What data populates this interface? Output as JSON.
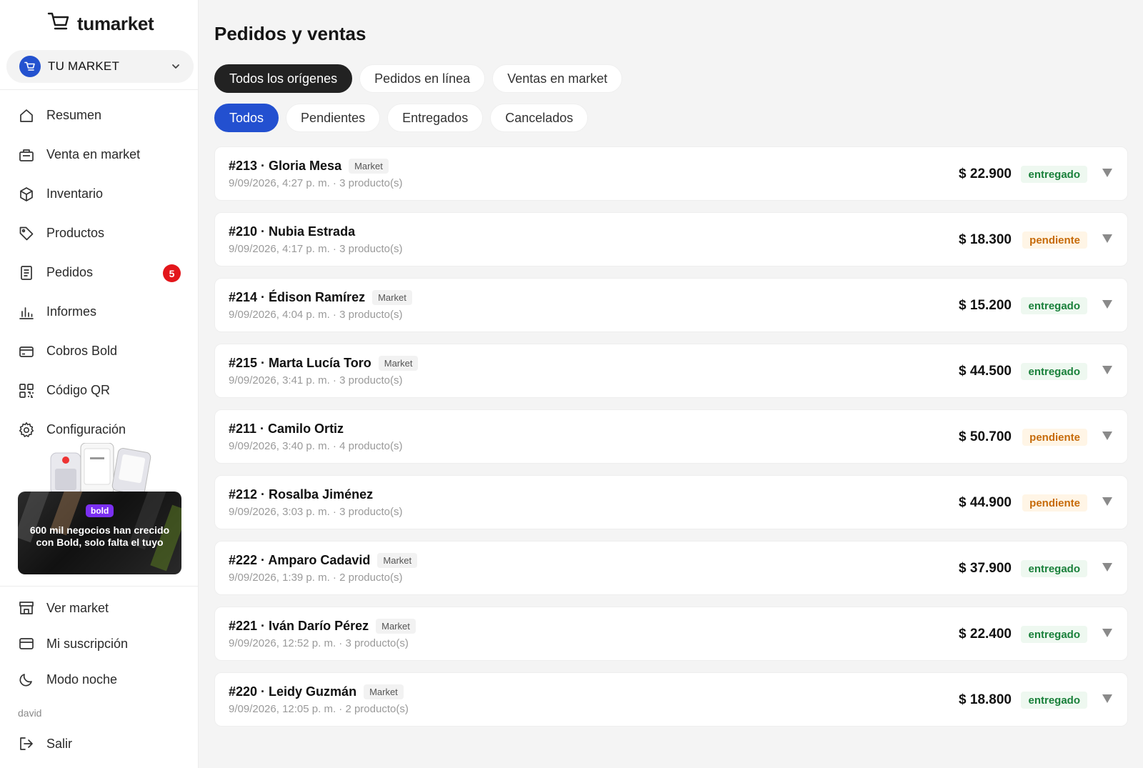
{
  "brand": {
    "name": "tumarket",
    "logo_icon": "cart-icon"
  },
  "store": {
    "name": "TU MARKET",
    "icon": "cart-icon"
  },
  "nav": [
    {
      "label": "Resumen",
      "icon": "home-icon"
    },
    {
      "label": "Venta en market",
      "icon": "register-icon"
    },
    {
      "label": "Inventario",
      "icon": "box-icon"
    },
    {
      "label": "Productos",
      "icon": "tag-icon"
    },
    {
      "label": "Pedidos",
      "icon": "document-icon",
      "badge": "5"
    },
    {
      "label": "Informes",
      "icon": "bar-chart-icon"
    },
    {
      "label": "Cobros Bold",
      "icon": "credit-card-icon"
    },
    {
      "label": "Código QR",
      "icon": "qr-code-icon"
    },
    {
      "label": "Configuración",
      "icon": "gear-icon"
    }
  ],
  "promo": {
    "brand": "bold",
    "text": "600 mil negocios han crecido con Bold, solo falta el tuyo"
  },
  "bottom_nav": [
    {
      "label": "Ver market",
      "icon": "storefront-icon"
    },
    {
      "label": "Mi suscripción",
      "icon": "card-icon"
    },
    {
      "label": "Modo noche",
      "icon": "moon-icon"
    }
  ],
  "user": {
    "name": "david",
    "logout_label": "Salir"
  },
  "page": {
    "title": "Pedidos y ventas"
  },
  "source_filters": [
    {
      "label": "Todos los orígenes",
      "active": true
    },
    {
      "label": "Pedidos en línea",
      "active": false
    },
    {
      "label": "Ventas en market",
      "active": false
    }
  ],
  "status_filters": [
    {
      "label": "Todos",
      "active": true
    },
    {
      "label": "Pendientes",
      "active": false
    },
    {
      "label": "Entregados",
      "active": false
    },
    {
      "label": "Cancelados",
      "active": false
    }
  ],
  "orders": [
    {
      "title": "#213 · Gloria Mesa",
      "tag": "Market",
      "meta": "9/09/2026, 4:27 p. m. · 3 producto(s)",
      "amount": "$ 22.900",
      "status": "entregado"
    },
    {
      "title": "#210 · Nubia Estrada",
      "tag": "",
      "meta": "9/09/2026, 4:17 p. m. · 3 producto(s)",
      "amount": "$ 18.300",
      "status": "pendiente"
    },
    {
      "title": "#214 · Édison Ramírez",
      "tag": "Market",
      "meta": "9/09/2026, 4:04 p. m. · 3 producto(s)",
      "amount": "$ 15.200",
      "status": "entregado"
    },
    {
      "title": "#215 · Marta Lucía Toro",
      "tag": "Market",
      "meta": "9/09/2026, 3:41 p. m. · 3 producto(s)",
      "amount": "$ 44.500",
      "status": "entregado"
    },
    {
      "title": "#211 · Camilo Ortiz",
      "tag": "",
      "meta": "9/09/2026, 3:40 p. m. · 4 producto(s)",
      "amount": "$ 50.700",
      "status": "pendiente"
    },
    {
      "title": "#212 · Rosalba Jiménez",
      "tag": "",
      "meta": "9/09/2026, 3:03 p. m. · 3 producto(s)",
      "amount": "$ 44.900",
      "status": "pendiente"
    },
    {
      "title": "#222 · Amparo Cadavid",
      "tag": "Market",
      "meta": "9/09/2026, 1:39 p. m. · 2 producto(s)",
      "amount": "$ 37.900",
      "status": "entregado"
    },
    {
      "title": "#221 · Iván Darío Pérez",
      "tag": "Market",
      "meta": "9/09/2026, 12:52 p. m. · 3 producto(s)",
      "amount": "$ 22.400",
      "status": "entregado"
    },
    {
      "title": "#220 · Leidy Guzmán",
      "tag": "Market",
      "meta": "9/09/2026, 12:05 p. m. · 2 producto(s)",
      "amount": "$ 18.800",
      "status": "entregado"
    }
  ],
  "colors": {
    "accent_blue": "#2350d0",
    "dark_chip": "#222222",
    "badge_red": "#e3161b",
    "status_delivered": "#19803a",
    "status_pending": "#c66a08",
    "promo_brand": "#7b2ff2"
  }
}
